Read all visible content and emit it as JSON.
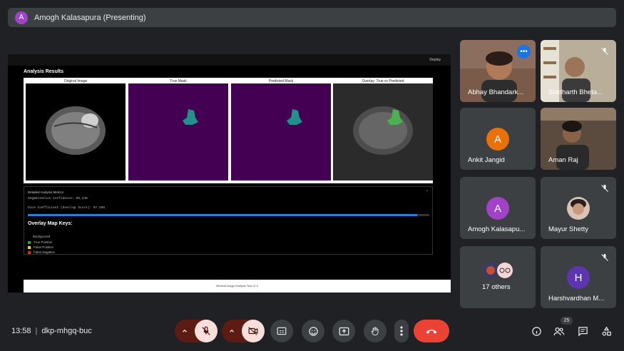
{
  "presenter_bar": {
    "avatar_letter": "A",
    "title": "Amogh Kalasapura (Presenting)"
  },
  "shared_screen": {
    "deploy_label": "Deploy",
    "analysis_title": "Analysis Results",
    "figures": [
      {
        "label": "Original Image"
      },
      {
        "label": "True Mask"
      },
      {
        "label": "Predicted Mask"
      },
      {
        "label": "Overlay: True vs Predicted"
      }
    ],
    "details": {
      "title": "Detailed Analysis Metrics",
      "segmentation_confidence": "Segmentation Confidence: 99.24%",
      "dice_coefficient": "Dice Coefficient (Overlap Score): 97.28%",
      "progress": 0.97
    },
    "overlay_keys": {
      "title": "Overlay Map Keys:",
      "heading": "Background",
      "items": [
        {
          "label": "True Positive",
          "color": "#2ca02c"
        },
        {
          "label": "False Positive",
          "color": "#e5e000"
        },
        {
          "label": "False Negative",
          "color": "#d62728"
        }
      ]
    },
    "footer": "Medical Image Analysis Tool v1.0"
  },
  "participants": [
    {
      "name": "Abhay Bhandark...",
      "type": "video"
    },
    {
      "name": "Siddharth Bheta...",
      "type": "video"
    },
    {
      "name": "Ankit Jangid",
      "type": "avatar",
      "letter": "A",
      "color": "#e8710a"
    },
    {
      "name": "Aman Raj",
      "type": "video"
    },
    {
      "name": "Amogh Kalasapu...",
      "type": "avatar",
      "letter": "A",
      "color": "#a142c8"
    },
    {
      "name": "Mayur Shetty",
      "type": "photo"
    },
    {
      "name": "17 others",
      "type": "group"
    },
    {
      "name": "Harshvardhan M...",
      "type": "avatar",
      "letter": "H",
      "color": "#5e35b1"
    }
  ],
  "bottom": {
    "time": "13:58",
    "separator": "|",
    "meeting_code": "dkp-mhgq-buc",
    "people_count": "25"
  },
  "icons": [
    "mic-off-icon",
    "camera-off-icon",
    "captions-icon",
    "emoji-icon",
    "present-icon",
    "raise-hand-icon",
    "more-vert-icon",
    "end-call-icon",
    "info-icon",
    "people-icon",
    "chat-icon",
    "activities-icon"
  ]
}
